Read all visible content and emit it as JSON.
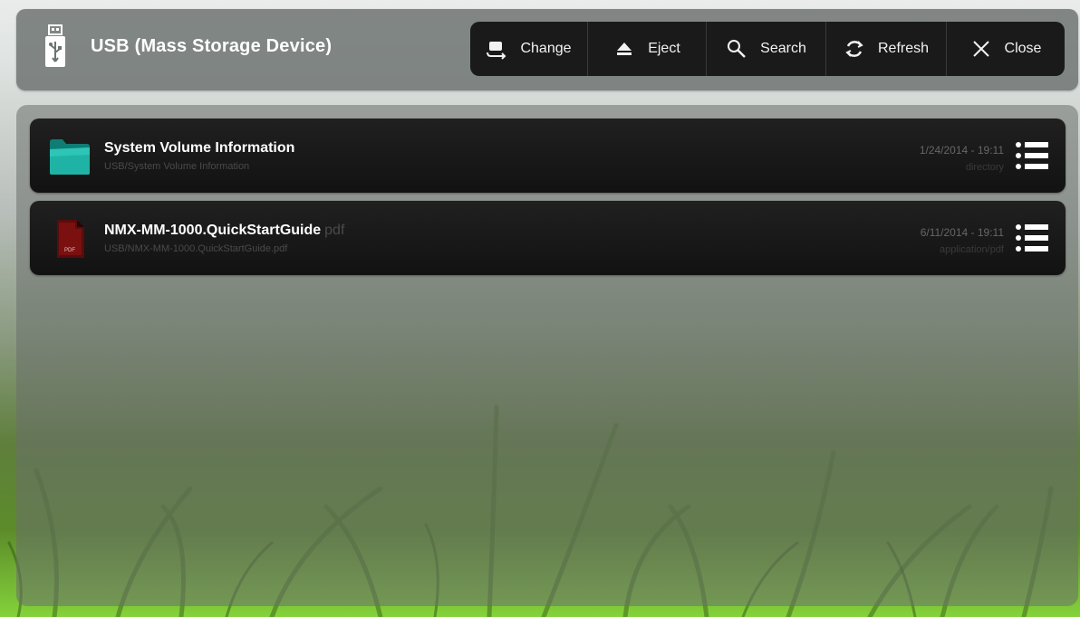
{
  "header": {
    "title": "USB (Mass Storage Device)",
    "icon": "usb-icon"
  },
  "toolbar": {
    "buttons": [
      {
        "label": "Change",
        "icon": "change-drive-icon"
      },
      {
        "label": "Eject",
        "icon": "eject-icon"
      },
      {
        "label": "Search",
        "icon": "search-icon"
      },
      {
        "label": "Refresh",
        "icon": "refresh-icon"
      },
      {
        "label": "Close",
        "icon": "close-icon"
      }
    ]
  },
  "files": [
    {
      "name": "System Volume Information",
      "ext": "",
      "path": "USB/System Volume Information",
      "date": "1/24/2014 - 19:11",
      "type": "directory",
      "icon": "folder-icon"
    },
    {
      "name": "NMX-MM-1000.QuickStartGuide",
      "ext": "pdf",
      "path": "USB/NMX-MM-1000.QuickStartGuide.pdf",
      "date": "6/11/2014 - 19:11",
      "type": "application/pdf",
      "icon": "pdf-icon",
      "icon_label": "PDF"
    }
  ],
  "colors": {
    "folder": "#1fb3a6",
    "pdf": "#8a1212",
    "row_bg": "#161616",
    "text": "#ffffff"
  }
}
